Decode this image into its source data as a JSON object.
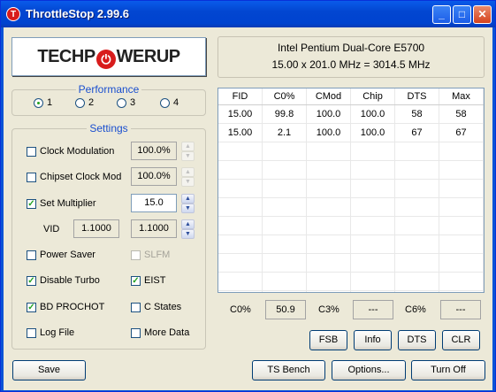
{
  "window": {
    "title": "ThrottleStop 2.99.6",
    "app_icon_letter": "T"
  },
  "logo": {
    "left": "TECHP",
    "right": "WERUP"
  },
  "cpu": {
    "name": "Intel Pentium Dual-Core E5700",
    "freq": "15.00 x 201.0 MHz = 3014.5 MHz"
  },
  "performance": {
    "title": "Performance",
    "options": [
      {
        "label": "1",
        "selected": true
      },
      {
        "label": "2",
        "selected": false
      },
      {
        "label": "3",
        "selected": false
      },
      {
        "label": "4",
        "selected": false
      }
    ]
  },
  "settings": {
    "title": "Settings",
    "clock_modulation": {
      "label": "Clock Modulation",
      "checked": false,
      "value": "100.0%"
    },
    "chipset_clock_mod": {
      "label": "Chipset Clock Mod",
      "checked": false,
      "value": "100.0%"
    },
    "set_multiplier": {
      "label": "Set Multiplier",
      "checked": true,
      "value": "15.0"
    },
    "vid": {
      "label": "VID",
      "value1": "1.1000",
      "value2": "1.1000"
    },
    "power_saver": {
      "label": "Power Saver",
      "checked": false
    },
    "slfm": {
      "label": "SLFM",
      "checked": false
    },
    "disable_turbo": {
      "label": "Disable Turbo",
      "checked": true
    },
    "eist": {
      "label": "EIST",
      "checked": true
    },
    "bd_prochot": {
      "label": "BD PROCHOT",
      "checked": true
    },
    "c_states": {
      "label": "C States",
      "checked": false
    },
    "log_file": {
      "label": "Log File",
      "checked": false
    },
    "more_data": {
      "label": "More Data",
      "checked": false
    }
  },
  "table": {
    "headers": [
      "FID",
      "C0%",
      "CMod",
      "Chip",
      "DTS",
      "Max"
    ],
    "rows": [
      [
        "15.00",
        "99.8",
        "100.0",
        "100.0",
        "58",
        "58"
      ],
      [
        "15.00",
        "2.1",
        "100.0",
        "100.0",
        "67",
        "67"
      ]
    ]
  },
  "stats": {
    "c0_label": "C0%",
    "c0_value": "50.9",
    "c3_label": "C3%",
    "c3_value": "---",
    "c6_label": "C6%",
    "c6_value": "---"
  },
  "buttons": {
    "fsb": "FSB",
    "info": "Info",
    "dts": "DTS",
    "clr": "CLR",
    "save": "Save",
    "ts_bench": "TS Bench",
    "options": "Options...",
    "turn_off": "Turn Off"
  },
  "check_glyph": "✓",
  "colors": {
    "titlebar": "#0a53d6",
    "client_bg": "#ece9d8",
    "group_title": "#1a4fcf",
    "check": "#21a121"
  }
}
